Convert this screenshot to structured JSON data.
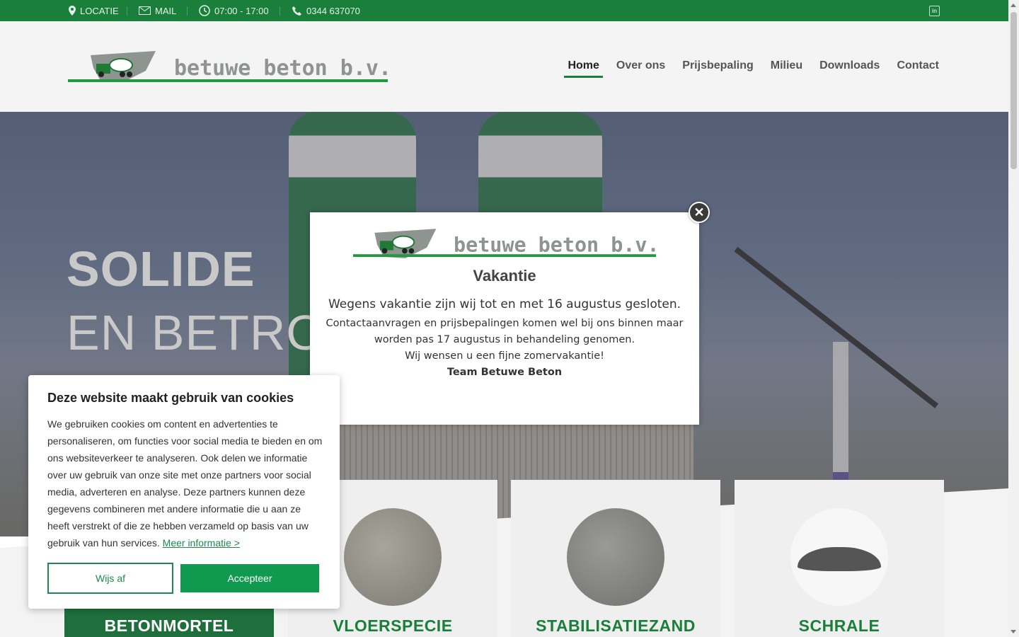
{
  "topbar": {
    "location": "LOCATIE",
    "mail": "MAIL",
    "hours": "07:00 - 17:00",
    "phone": "0344 637070",
    "linkedin": "in"
  },
  "header": {
    "brand": "betuwe beton b.v.",
    "nav": [
      "Home",
      "Over ons",
      "Prijsbepaling",
      "Milieu",
      "Downloads",
      "Contact"
    ],
    "active": "Home"
  },
  "hero": {
    "line1": "SOLIDE",
    "line2": "EN BETROUWBAAR"
  },
  "products": [
    "BETONMORTEL",
    "VLOERSPECIE",
    "STABILISATIEZAND",
    "SCHRALE"
  ],
  "modal": {
    "brand": "betuwe beton b.v.",
    "title": "Vakantie",
    "lead": "Wegens vakantie zijn wij tot en met 16 augustus gesloten.",
    "line1": "Contactaanvragen en prijsbepalingen komen wel bij ons binnen maar worden pas 17 augustus in behandeling genomen.",
    "line2": "Wij wensen u een fijne zomervakantie!",
    "team": "Team Betuwe Beton",
    "close": "✕"
  },
  "cookie": {
    "title": "Deze website maakt gebruik van cookies",
    "text": "We gebruiken cookies om content en advertenties te personaliseren, om functies voor social media te bieden en om ons websiteverkeer te analyseren. Ook delen we informatie over uw gebruik van onze site met onze partners voor social media, adverteren en analyse. Deze partners kunnen deze gegevens combineren met andere informatie die u aan ze heeft verstrekt of die ze hebben verzameld op basis van uw gebruik van hun services.",
    "more": "Meer informatie >",
    "deny": "Wijs af",
    "accept": "Accepteer"
  },
  "colors": {
    "brand_green": "#1b7f3c",
    "accept_green": "#0f9a4f"
  }
}
